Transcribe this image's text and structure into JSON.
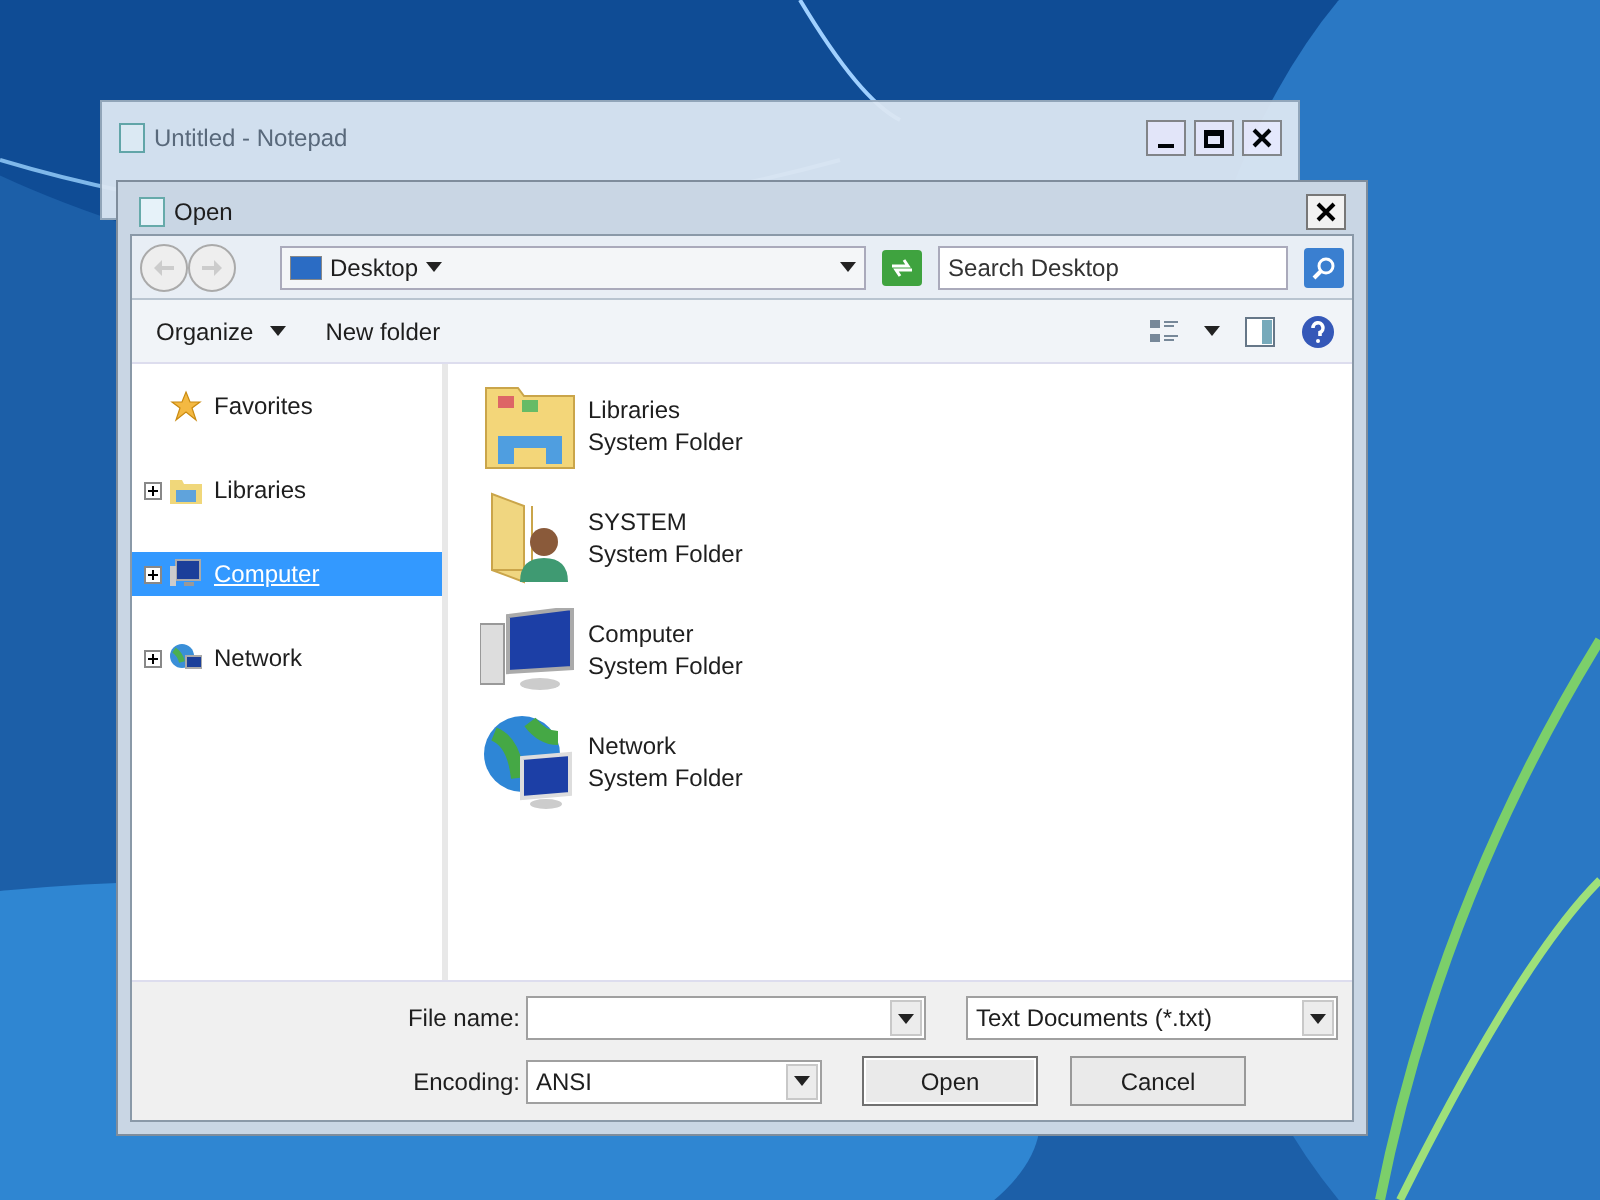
{
  "background_window": {
    "title": "Untitled - Notepad"
  },
  "dialog": {
    "title": "Open"
  },
  "address_bar": {
    "location": "Desktop"
  },
  "search": {
    "placeholder": "Search Desktop"
  },
  "toolbar": {
    "organize": "Organize",
    "new_folder": "New folder"
  },
  "sidebar": {
    "items": [
      {
        "label": "Favorites",
        "kind": "favorites",
        "expandable": false,
        "selected": false
      },
      {
        "label": "Libraries",
        "kind": "libraries",
        "expandable": true,
        "selected": false
      },
      {
        "label": "Computer",
        "kind": "computer",
        "expandable": true,
        "selected": true
      },
      {
        "label": "Network",
        "kind": "network",
        "expandable": true,
        "selected": false
      }
    ]
  },
  "items": [
    {
      "name": "Libraries",
      "type": "System Folder",
      "kind": "libraries"
    },
    {
      "name": "SYSTEM",
      "type": "System Folder",
      "kind": "user"
    },
    {
      "name": "Computer",
      "type": "System Folder",
      "kind": "computer"
    },
    {
      "name": "Network",
      "type": "System Folder",
      "kind": "network"
    }
  ],
  "file_name": {
    "label": "File name:"
  },
  "file_type": {
    "value": "Text Documents (*.txt)"
  },
  "encoding": {
    "label": "Encoding:",
    "value": "ANSI"
  },
  "buttons": {
    "open": "Open",
    "cancel": "Cancel"
  }
}
